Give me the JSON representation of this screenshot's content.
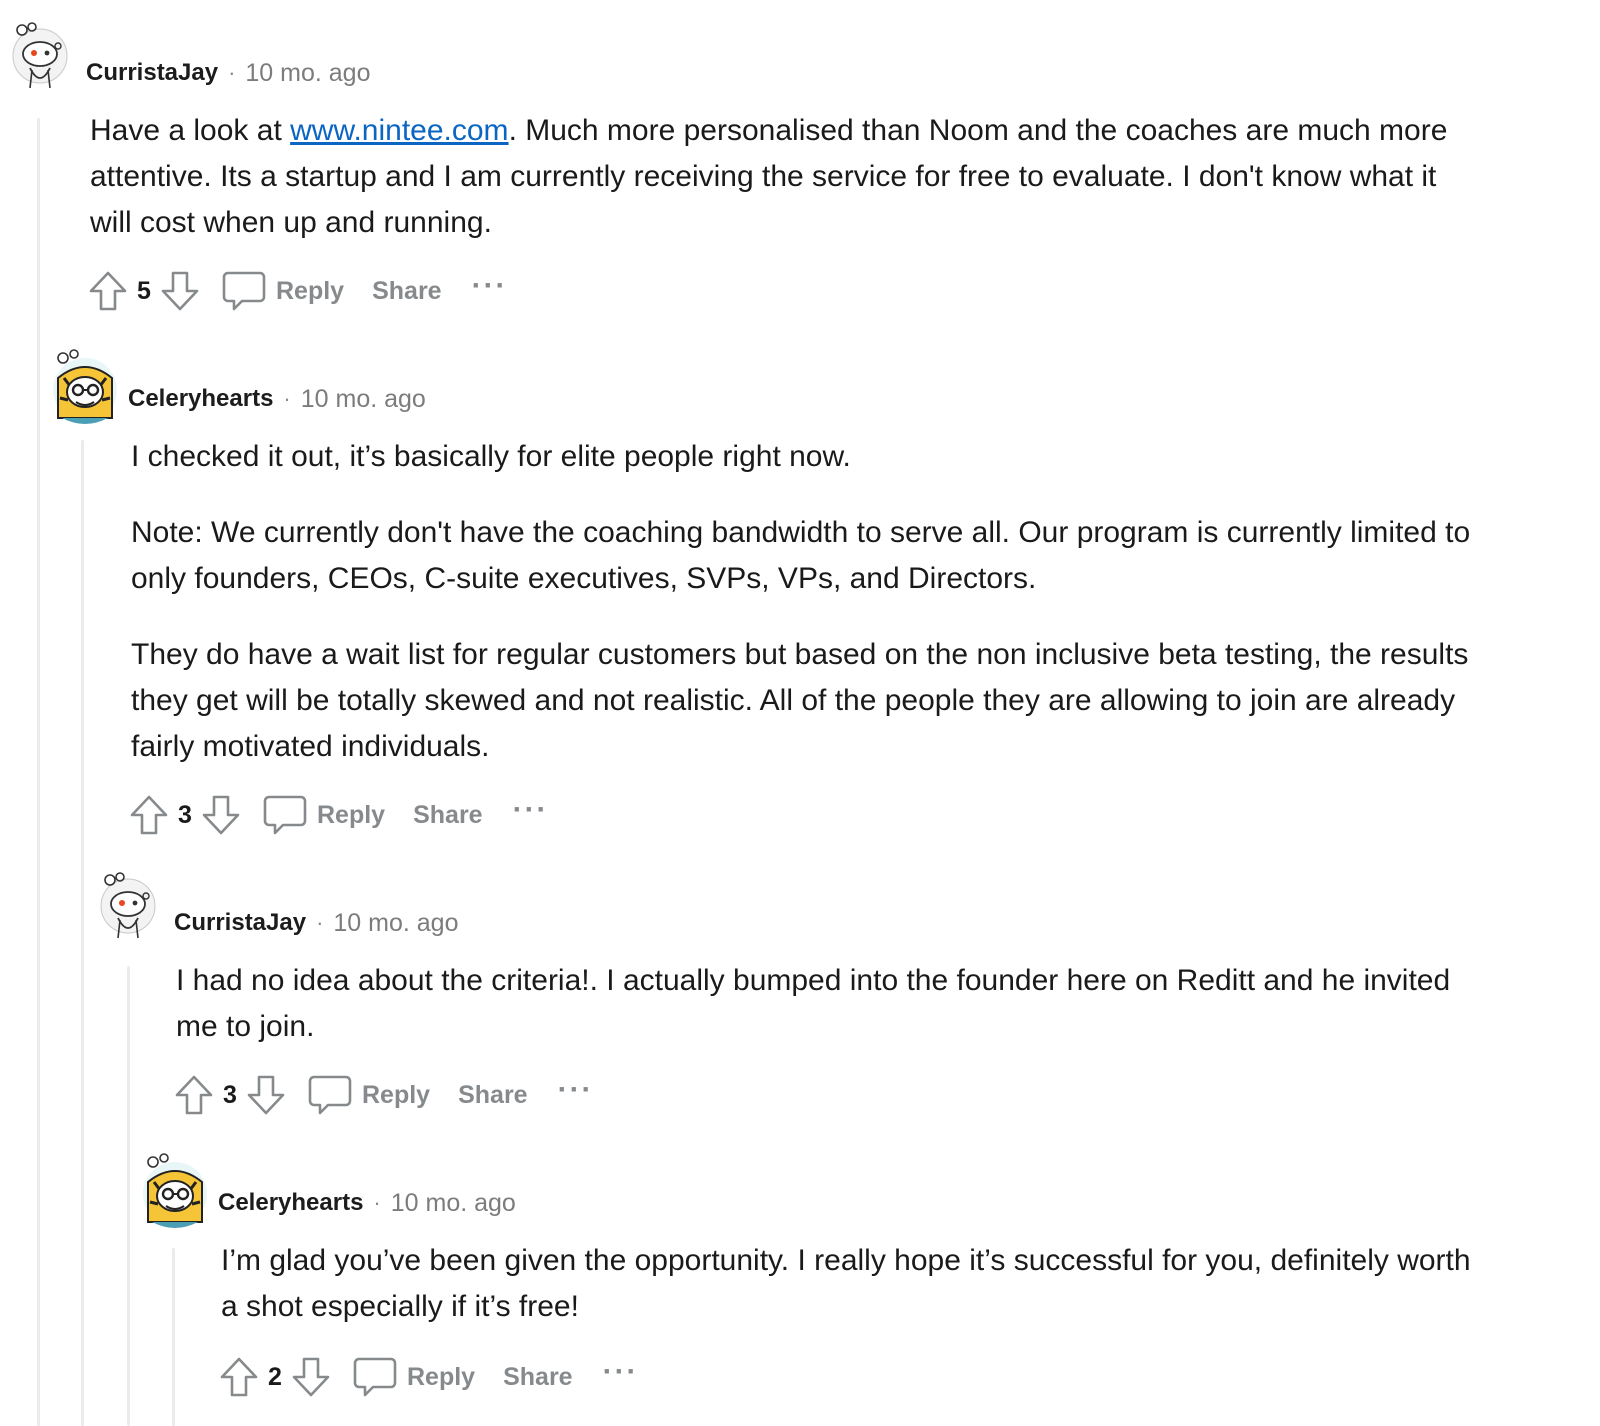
{
  "comments": [
    {
      "author": "CurristaJay",
      "separator": "·",
      "time": "10 mo. ago",
      "avatar_icon": "reddit-snoo-avatar-icon",
      "body_prefix": "Have a look at ",
      "link_text": "www.nintee.com",
      "body_suffix": ". Much more personalised than Noom and the coaches are much more attentive. Its a startup and I am currently receiving the service for free to evaluate. I don't know what it will cost when up and running.",
      "score": "5",
      "reply_label": "Reply",
      "share_label": "Share",
      "more_label": "···"
    },
    {
      "author": "Celeryhearts",
      "separator": "·",
      "time": "10 mo. ago",
      "avatar_icon": "tiger-costume-avatar-icon",
      "paragraphs": [
        "I checked it out, it’s basically for elite people right now.",
        "Note: We currently don't have the coaching bandwidth to serve all. Our program is currently limited to only founders, CEOs, C-suite executives, SVPs, VPs, and Directors.",
        "They do have a wait list for regular customers but based on the non inclusive beta testing, the results they get will be totally skewed and not realistic. All of the people they are allowing to join are already fairly motivated individuals."
      ],
      "score": "3",
      "reply_label": "Reply",
      "share_label": "Share",
      "more_label": "···"
    },
    {
      "author": "CurristaJay",
      "separator": "·",
      "time": "10 mo. ago",
      "avatar_icon": "reddit-snoo-avatar-icon",
      "paragraphs": [
        "I had no idea about the criteria!. I actually bumped into the founder here on Reditt and he invited me to join."
      ],
      "score": "3",
      "reply_label": "Reply",
      "share_label": "Share",
      "more_label": "···"
    },
    {
      "author": "Celeryhearts",
      "separator": "·",
      "time": "10 mo. ago",
      "avatar_icon": "tiger-costume-avatar-icon",
      "paragraphs": [
        "I’m glad you’ve been given the opportunity. I really hope it’s successful for you, definitely worth a shot especially if it’s free!"
      ],
      "score": "2",
      "reply_label": "Reply",
      "share_label": "Share",
      "more_label": "···"
    }
  ],
  "colors": {
    "text": "#1a1a1b",
    "meta": "#7c7c7c",
    "action": "#878a8c",
    "link": "#0a66c2",
    "thread_line": "#e9ebed"
  }
}
